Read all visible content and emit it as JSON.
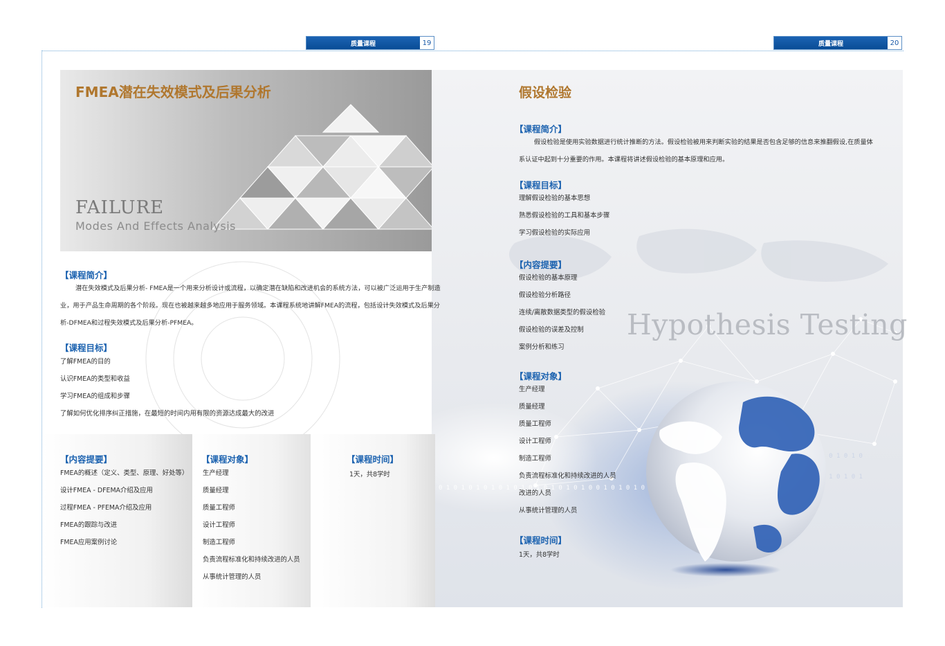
{
  "header": {
    "left_tab": {
      "label": "质量课程",
      "page": "19"
    },
    "right_tab": {
      "label": "质量课程",
      "page": "20"
    }
  },
  "left_page": {
    "title": "FMEA潜在失效模式及后果分析",
    "hero_word1": "FAILURE",
    "hero_word2": "Modes And Effects Analysis",
    "intro": {
      "heading": "【课程简介】",
      "lines": [
        "潜在失效模式及后果分析- FMEA是一个用来分析设计或流程，以确定潜在缺陷和改进机会的系统方法，可以被广泛运用于生产制造",
        "业，用于产品生命周期的各个阶段。现在也被越来越多地应用于服务领域。本课程系统地讲解FMEA的流程，包括设计失效模式及后果分",
        "析-DFMEA和过程失效模式及后果分析-PFMEA。"
      ]
    },
    "goals": {
      "heading": "【课程目标】",
      "items": [
        "了解FMEA的目的",
        "认识FMEA的类型和收益",
        "学习FMEA的组成和步骤",
        "了解如何优化排序纠正措施，在最短的时间内用有限的资源达成最大的改进"
      ]
    },
    "content": {
      "heading": "【内容提要】",
      "items": [
        "FMEA的概述（定义、类型、原理、好处等）",
        "设计FMEA - DFEMA介绍及应用",
        "过程FMEA - PFEMA介绍及应用",
        "FMEA的跟踪与改进",
        "FMEA应用案例讨论"
      ]
    },
    "audience": {
      "heading": "【课程对象】",
      "items": [
        "生产经理",
        "质量经理",
        "质量工程师",
        "设计工程师",
        "制造工程师",
        "负责流程标准化和持续改进的人员",
        "从事统计管理的人员"
      ]
    },
    "duration": {
      "heading": "【课程时间】",
      "text": "1天，共8学时"
    }
  },
  "right_page": {
    "title": "假设检验",
    "watermark": "Hypothesis Testing",
    "intro": {
      "heading": "【课程简介】",
      "lines": [
        "假设检验是使用实验数据进行统计推断的方法。假设检验被用来判断实验的结果是否包含足够的信息来推翻假设,在质量体",
        "系认证中起到十分重要的作用。本课程将讲述假设检验的基本原理和应用。"
      ]
    },
    "goals": {
      "heading": "【课程目标】",
      "items": [
        "理解假设检验的基本思想",
        "熟悉假设检验的工具和基本步骤",
        "学习假设检验的实际应用"
      ]
    },
    "content": {
      "heading": "【内容提要】",
      "items": [
        "假设检验的基本原理",
        "假设检验分析路径",
        "连续/离散数据类型的假设检验",
        "假设检验的误差及控制",
        "案例分析和练习"
      ]
    },
    "audience": {
      "heading": "【课程对象】",
      "items": [
        "生产经理",
        "质量经理",
        "质量工程师",
        "设计工程师",
        "制造工程师",
        "负责流程标准化和持续改进的人员",
        "改进的人员",
        "从事统计管理的人员"
      ]
    },
    "duration": {
      "heading": "【课程时间】",
      "text": "1天，共8学时"
    }
  },
  "colors": {
    "heading_blue": "#1d63b0",
    "title_gold": "#b0772e",
    "tab_blue": "#0a4d96",
    "globe_blue": "#2d5fb5"
  }
}
